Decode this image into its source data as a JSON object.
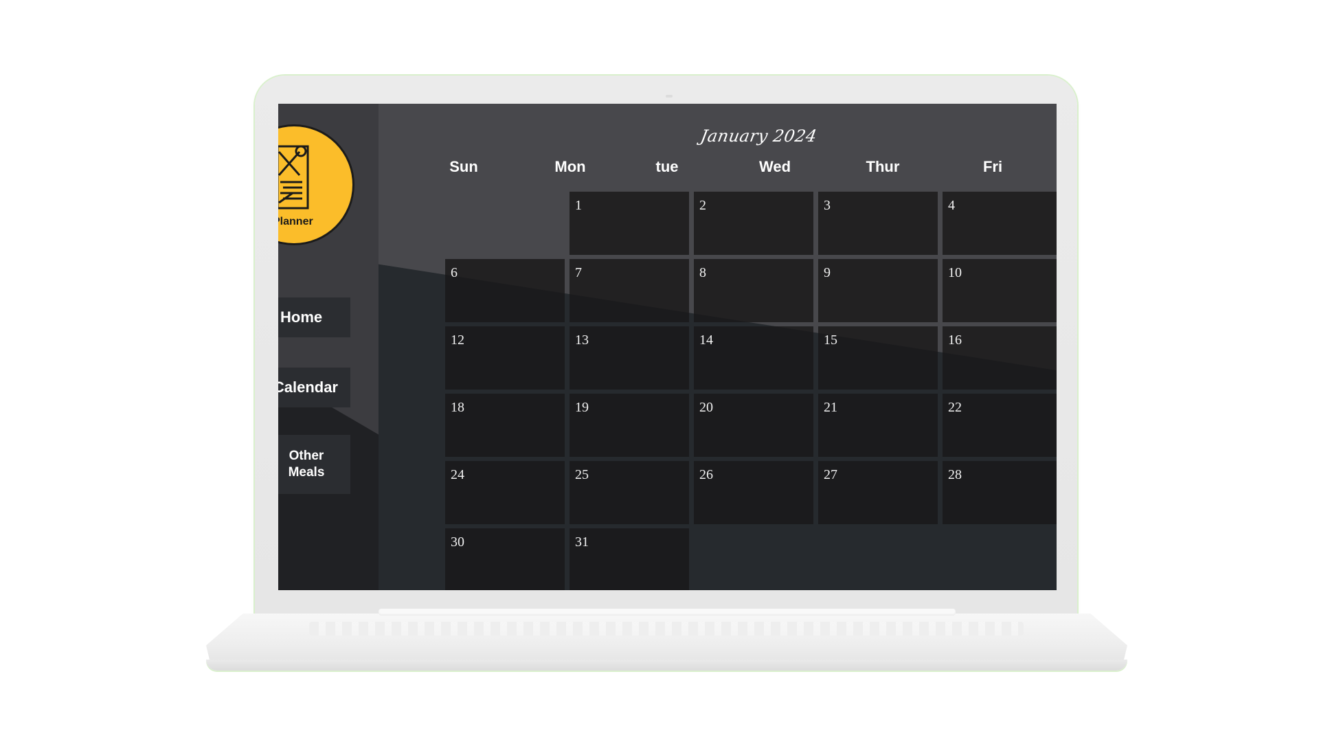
{
  "app": {
    "logo_text": "Planner"
  },
  "nav": {
    "home_label": "Home",
    "calendar_label": "Calendar",
    "other_line1": "Other",
    "other_line2": "Meals"
  },
  "calendar": {
    "month_title": "January 2024",
    "weekdays": [
      "Sun",
      "Mon",
      "tue",
      "Wed",
      "Thur",
      "Fri"
    ],
    "days": [
      "1",
      "2",
      "3",
      "4",
      "6",
      "7",
      "8",
      "9",
      "10",
      "12",
      "13",
      "14",
      "15",
      "16",
      "18",
      "19",
      "20",
      "21",
      "22",
      "24",
      "25",
      "26",
      "27",
      "28",
      "30",
      "31"
    ]
  },
  "colors": {
    "logo_yellow": "#fbbd2a",
    "sidebar": "#202124",
    "cell": "#1a191a",
    "nav_button": "#2b2d31",
    "text": "#ffffff"
  }
}
